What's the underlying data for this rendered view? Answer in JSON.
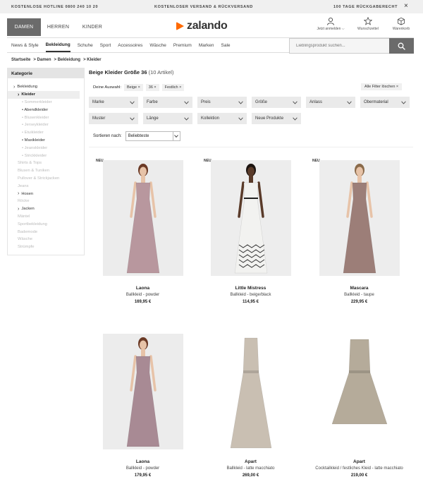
{
  "topbar": {
    "hotline": "KOSTENLOSE HOTLINE 0800 240 10 20",
    "shipping": "KOSTENLOSER VERSAND & RÜCKVERSAND",
    "returns": "100 TAGE RÜCKGABERECHT",
    "close": "×"
  },
  "header": {
    "tabs": [
      "DAMEN",
      "HERREN",
      "KINDER"
    ],
    "logo": "zalando",
    "tools": [
      "Jetzt anmelden ⌵",
      "Wunschzettel",
      "Warenkorb"
    ]
  },
  "nav": {
    "items": [
      "News & Style",
      "Bekleidung",
      "Schuhe",
      "Sport",
      "Accessoires",
      "Wäsche",
      "Premium",
      "Marken",
      "Sale"
    ],
    "search_placeholder": "Lieblingsprodukt suchen..."
  },
  "breadcrumb": [
    "Startseite",
    "> Damen",
    "> Bekleidung",
    "> Kleider"
  ],
  "sidebar": {
    "title": "Kategorie",
    "items": [
      {
        "label": "Bekleidung",
        "level": 0,
        "style": "dark",
        "caret": true
      },
      {
        "label": "Kleider",
        "level": 1,
        "style": "active",
        "caret": true
      },
      {
        "label": "• Sommerkleider",
        "level": 2,
        "style": "muted"
      },
      {
        "label": "• Abendkleider",
        "level": 2,
        "style": "dark"
      },
      {
        "label": "• Blusenkleider",
        "level": 2,
        "style": "muted"
      },
      {
        "label": "• Jerseykleider",
        "level": 2,
        "style": "muted"
      },
      {
        "label": "• Etuikleider",
        "level": 2,
        "style": "muted"
      },
      {
        "label": "• Maxikleider",
        "level": 2,
        "style": "dark"
      },
      {
        "label": "• Jeanskleider",
        "level": 2,
        "style": "muted"
      },
      {
        "label": "• Strickkleider",
        "level": 2,
        "style": "muted"
      },
      {
        "label": "Shirts & Tops",
        "level": 1,
        "style": "muted"
      },
      {
        "label": "Blusen & Tuniken",
        "level": 1,
        "style": "muted"
      },
      {
        "label": "Pullover & Strickjacken",
        "level": 1,
        "style": "muted"
      },
      {
        "label": "Jeans",
        "level": 1,
        "style": "muted"
      },
      {
        "label": "Hosen",
        "level": 1,
        "style": "dark",
        "caret": true
      },
      {
        "label": "Röcke",
        "level": 1,
        "style": "muted"
      },
      {
        "label": "Jacken",
        "level": 1,
        "style": "dark",
        "caret": true
      },
      {
        "label": "Mäntel",
        "level": 1,
        "style": "muted"
      },
      {
        "label": "Sportbekleidung",
        "level": 1,
        "style": "muted"
      },
      {
        "label": "Bademode",
        "level": 1,
        "style": "muted"
      },
      {
        "label": "Wäsche",
        "level": 1,
        "style": "muted"
      },
      {
        "label": "Strümpfe",
        "level": 1,
        "style": "muted"
      }
    ]
  },
  "results": {
    "title": "Beige Kleider Größe 36",
    "count": "(10 Artikel)"
  },
  "selection": {
    "label": "Deine Auswahl:",
    "chips": [
      "Beige ×",
      "36 ×",
      "Festlich ×"
    ],
    "reset": "Alle Filter löschen ×"
  },
  "filters": {
    "row1": [
      "Marke",
      "Farbe",
      "Preis",
      "Größe",
      "Anlass",
      "Obermaterial"
    ],
    "row2": [
      "Muster",
      "Länge",
      "Kollektion",
      "Neue Produkte"
    ]
  },
  "sort": {
    "label": "Sortieren nach:",
    "value": "Beliebteste"
  },
  "products": [
    {
      "brand": "Laona",
      "name": "Ballkleid - powder",
      "price": "169,95 €",
      "badge": "NEU",
      "dress": "#b8979e",
      "bg": "#ececec"
    },
    {
      "brand": "Little Mistress",
      "name": "Ballkleid - beige/black",
      "price": "114,95 €",
      "badge": "NEU",
      "dress": "#f2f2f0",
      "bg": "#ededed"
    },
    {
      "brand": "Mascara",
      "name": "Ballkleid - taupe",
      "price": "229,95 €",
      "badge": "NEU",
      "dress": "#9c7e78",
      "bg": "#ededed"
    },
    {
      "brand": "Laona",
      "name": "Ballkleid - powder",
      "price": "179,95 €",
      "badge": "",
      "dress": "#a88a94",
      "bg": "#ececec"
    },
    {
      "brand": "Apart",
      "name": "Ballkleid - latte macchiato",
      "price": "269,00 €",
      "badge": "",
      "dress": "#c9bfb2",
      "bg": "#ffffff"
    },
    {
      "brand": "Apart",
      "name": "Cocktailkleid / festliches Kleid - latte macchiato",
      "price": "219,00 €",
      "badge": "",
      "dress": "#b5ab9a",
      "bg": "#ffffff"
    }
  ]
}
